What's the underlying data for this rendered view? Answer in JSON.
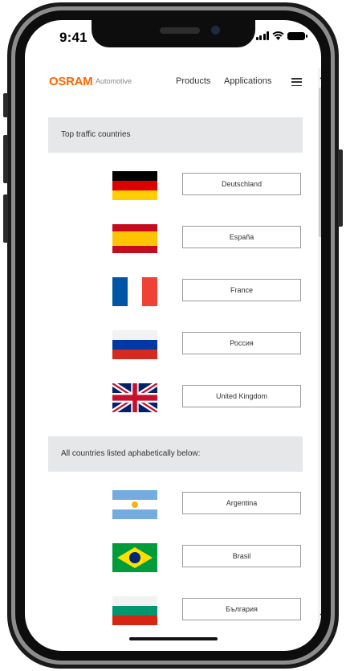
{
  "status_bar": {
    "time": "9:41"
  },
  "header": {
    "logo": "OSRAM",
    "logo_sub": "Automotive",
    "nav": {
      "products": "Products",
      "applications": "Applications"
    }
  },
  "top_section": {
    "title": "Top traffic countries",
    "countries": [
      {
        "label": "Deutschland"
      },
      {
        "label": "España"
      },
      {
        "label": "France"
      },
      {
        "label": "Россия"
      },
      {
        "label": "United Kingdom"
      }
    ]
  },
  "all_section": {
    "title": "All countries listed aphabetically below:",
    "countries": [
      {
        "label": "Argentina"
      },
      {
        "label": "Brasil"
      },
      {
        "label": "България"
      }
    ]
  },
  "colors": {
    "brand": "#ff6600",
    "section_bg": "#e5e7e9"
  }
}
